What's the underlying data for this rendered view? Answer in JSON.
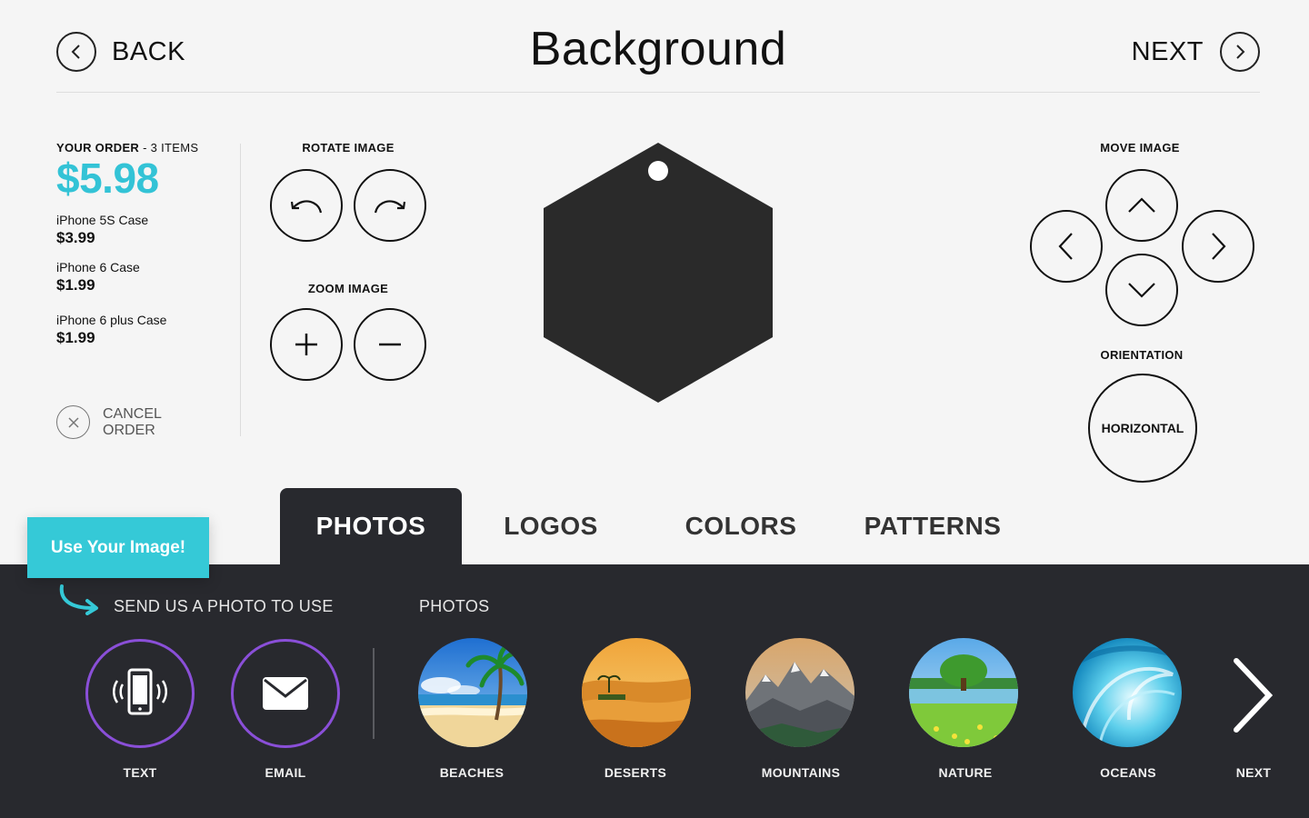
{
  "header": {
    "back_label": "BACK",
    "title": "Background",
    "next_label": "NEXT"
  },
  "order": {
    "heading": "YOUR ORDER",
    "count": "- 3 ITEMS",
    "total": "$5.98",
    "items": [
      {
        "name": "iPhone 5S Case",
        "price": "$3.99"
      },
      {
        "name": "iPhone 6 Case",
        "price": "$1.99"
      },
      {
        "name": "iPhone 6 plus Case",
        "price": "$1.99"
      }
    ],
    "cancel_label": "CANCEL ORDER"
  },
  "controls": {
    "rotate_title": "ROTATE IMAGE",
    "zoom_title": "ZOOM IMAGE",
    "move_title": "MOVE IMAGE",
    "orientation_title": "ORIENTATION",
    "orientation_value": "HORIZONTAL"
  },
  "tabs": [
    {
      "label": "PHOTOS",
      "active": true
    },
    {
      "label": "LOGOS",
      "active": false
    },
    {
      "label": "COLORS",
      "active": false
    },
    {
      "label": "PATTERNS",
      "active": false
    }
  ],
  "use_image_label": "Use Your Image!",
  "panel": {
    "send_label": "SEND US A PHOTO TO USE",
    "photos_label": "PHOTOS",
    "send_options": [
      {
        "label": "TEXT",
        "icon": "phone-icon"
      },
      {
        "label": "EMAIL",
        "icon": "envelope-icon"
      }
    ],
    "categories": [
      {
        "label": "BEACHES"
      },
      {
        "label": "DESERTS"
      },
      {
        "label": "MOUNTAINS"
      },
      {
        "label": "NATURE"
      },
      {
        "label": "OCEANS"
      }
    ],
    "next_label": "NEXT"
  },
  "colors": {
    "accent": "#35c9d7",
    "total": "#33c3d6",
    "panel": "#28292e",
    "send_ring": "#8a4fd8"
  }
}
